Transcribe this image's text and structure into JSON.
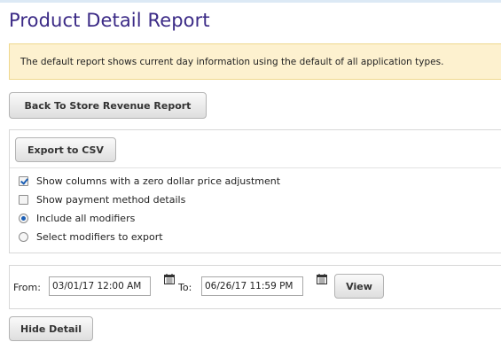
{
  "page": {
    "title": "Product Detail Report"
  },
  "alert": {
    "text": "The default report shows current day information using the default of all application types."
  },
  "buttons": {
    "back": "Back To Store Revenue Report",
    "export_csv": "Export to CSV",
    "view": "View",
    "hide_detail": "Hide Detail"
  },
  "options": [
    {
      "label": "Show columns with a zero dollar price adjustment",
      "type": "checkbox",
      "checked": true
    },
    {
      "label": "Show payment method details",
      "type": "checkbox",
      "checked": false
    },
    {
      "label": "Include all modifiers",
      "type": "radio",
      "checked": true
    },
    {
      "label": "Select modifiers to export",
      "type": "radio",
      "checked": false
    }
  ],
  "date_range": {
    "from_label": "From:",
    "from_value": "03/01/17 12:00 AM",
    "to_label": "To:",
    "to_value": "06/26/17 11:59 PM"
  },
  "icons": {
    "calendar": "calendar-icon"
  },
  "colors": {
    "title": "#3b2a86",
    "alert_bg": "#fdf1cf",
    "check": "#1c5fb5"
  }
}
